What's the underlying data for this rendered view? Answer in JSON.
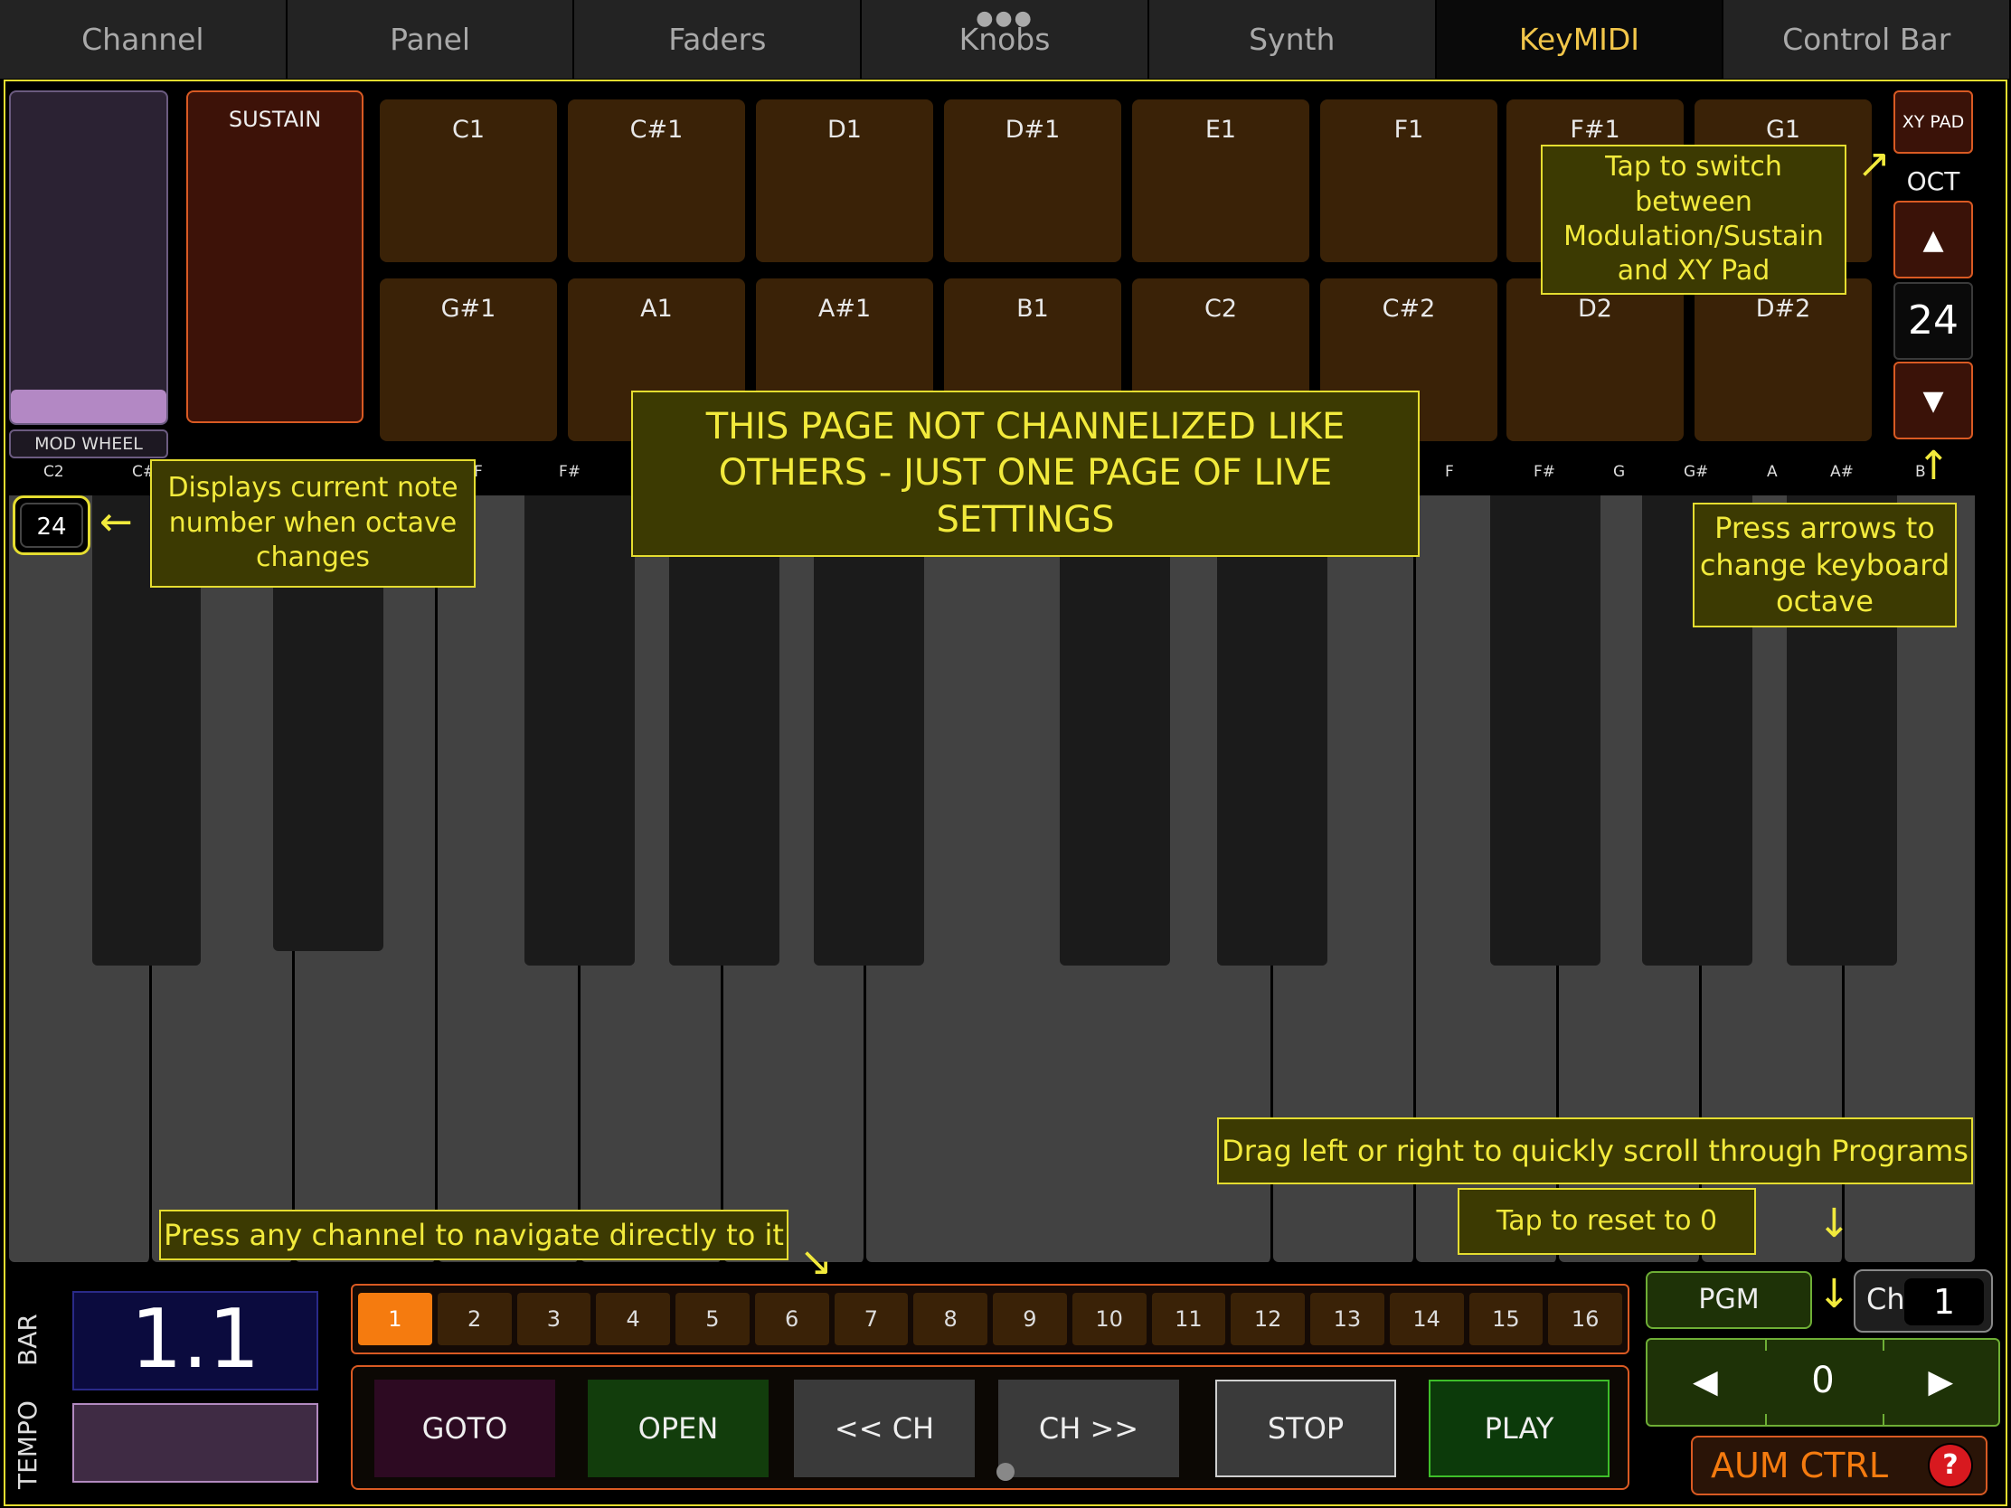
{
  "tabs": [
    {
      "label": "Channel"
    },
    {
      "label": "Panel"
    },
    {
      "label": "Faders"
    },
    {
      "label": "Knobs"
    },
    {
      "label": "Synth"
    },
    {
      "label": "KeyMIDI"
    },
    {
      "label": "Control Bar"
    }
  ],
  "active_tab": "KeyMIDI",
  "mod_wheel": {
    "label": "MOD WHEEL",
    "level_percent": 10
  },
  "sustain": {
    "label": "SUSTAIN"
  },
  "pads_row1": [
    "C1",
    "C#1",
    "D1",
    "D#1",
    "E1",
    "F1",
    "F#1",
    "G1"
  ],
  "pads_row2": [
    "G#1",
    "A1",
    "A#1",
    "B1",
    "C2",
    "C#2",
    "D2",
    "D#2"
  ],
  "xy_pad_label": "XY PAD",
  "octave": {
    "label": "OCT",
    "up": "▲",
    "value": "24",
    "down": "▼"
  },
  "keyboard": {
    "labels_left": [
      "C2",
      "C#"
    ],
    "label_f_sharp_1": "F#",
    "labels_right": [
      "F",
      "F#",
      "G",
      "G#",
      "A",
      "A#",
      "B"
    ],
    "label_f1": "F"
  },
  "note_display": "24",
  "callouts": {
    "note_display": "Displays current note number when octave changes",
    "not_channelized": "THIS PAGE NOT CHANNELIZED LIKE OTHERS - JUST ONE PAGE OF LIVE SETTINGS",
    "xy_switch": "Tap to switch between Modulation/Sustain and XY Pad",
    "octave_arrows": "Press arrows to change keyboard octave",
    "drag_programs": "Drag left or right to quickly scroll through Programs",
    "reset": "Tap to reset to 0",
    "channel_nav": "Press any channel to navigate directly to it"
  },
  "arrows": {
    "left": "←",
    "ne": "↗",
    "up": "↑",
    "down": "↓",
    "se": "↘"
  },
  "bar": {
    "label": "BAR",
    "value": "1.1"
  },
  "tempo": {
    "label": "TEMPO"
  },
  "channels": [
    "1",
    "2",
    "3",
    "4",
    "5",
    "6",
    "7",
    "8",
    "9",
    "10",
    "11",
    "12",
    "13",
    "14",
    "15",
    "16"
  ],
  "active_channel": "1",
  "transport": {
    "goto": "GOTO",
    "open": "OPEN",
    "prev_ch": "<< CH",
    "next_ch": "CH >>",
    "stop": "STOP",
    "play": "PLAY"
  },
  "pgm": {
    "label": "PGM",
    "value": "0",
    "left": "◀",
    "right": "▶"
  },
  "ch_selector": {
    "label": "Ch",
    "value": "1"
  },
  "aum_ctrl": {
    "label": "AUM CTRL",
    "help": "?"
  },
  "colors": {
    "accent": "#e5dd30",
    "active_tab": "#f2c64a",
    "orange": "#f57b0f",
    "pad": "#3a2207",
    "green": "#1e3207"
  }
}
